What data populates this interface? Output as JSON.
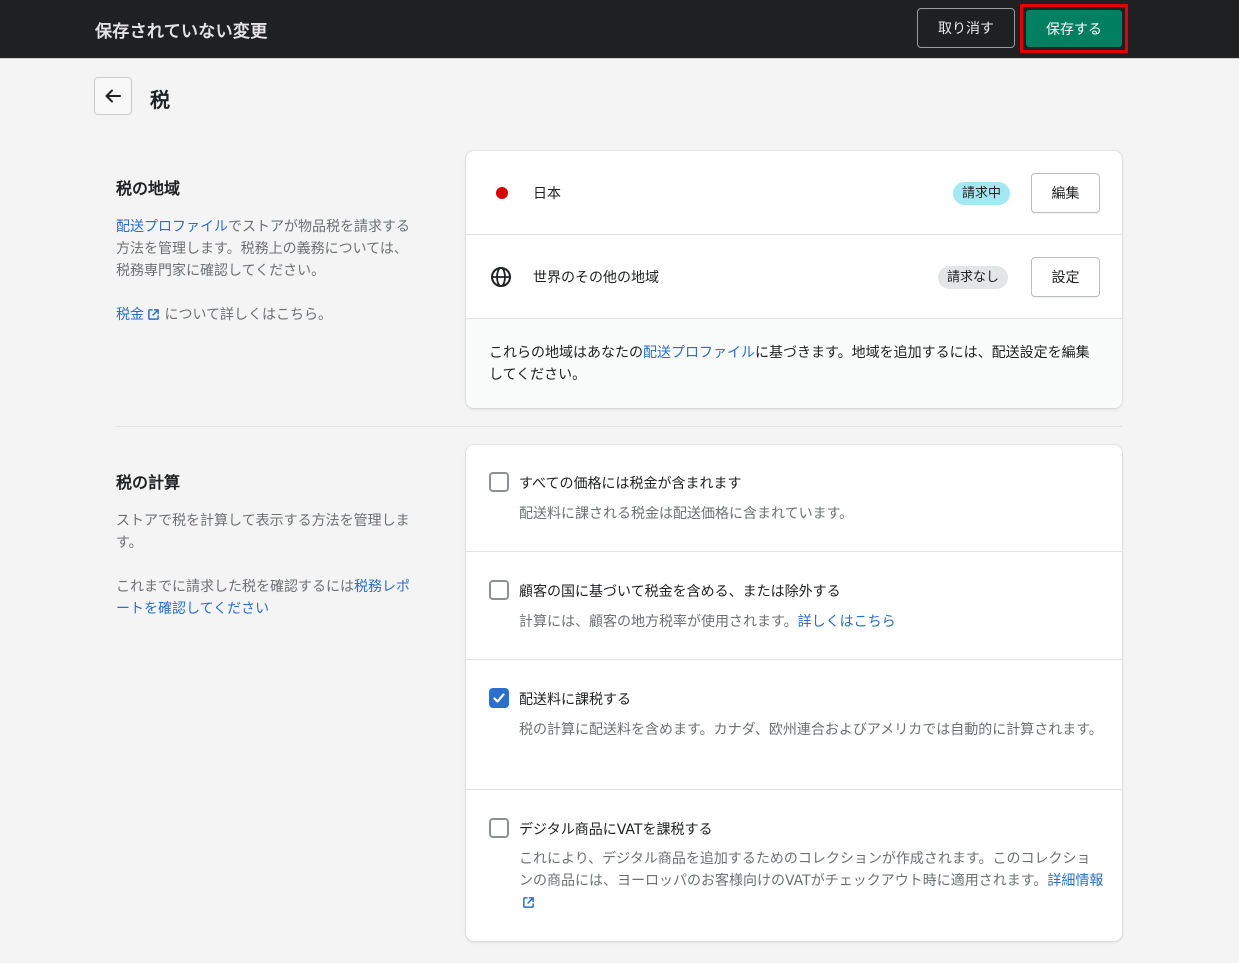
{
  "topbar": {
    "title": "保存されていない変更",
    "discard_label": "取り消す",
    "save_label": "保存する"
  },
  "page": {
    "title": "税",
    "back_icon": "arrow-left-icon"
  },
  "regions_section": {
    "title": "税の地域",
    "desc_link": "配送プロファイル",
    "desc_text": "でストアが物品税を請求する方法を管理します。税務上の義務については、税務専門家に確認してください。",
    "learn_link": "税金",
    "learn_text": "について詳しくはこちら。",
    "rows": [
      {
        "name": "日本",
        "icon": "red-dot-icon",
        "badge": "請求中",
        "button": "編集"
      },
      {
        "name": "世界のその他の地域",
        "icon": "globe-icon",
        "badge": "請求なし",
        "button": "設定"
      }
    ],
    "footer_pre": "これらの地域はあなたの",
    "footer_link": "配送プロファイル",
    "footer_post": "に基づきます。地域を追加するには、配送設定を編集してください。"
  },
  "calc_section": {
    "title": "税の計算",
    "desc": "ストアで税を計算して表示する方法を管理します。",
    "report_pre": "これまでに請求した税を確認するには",
    "report_link": "税務レポートを確認してください",
    "options": [
      {
        "label": "すべての価格には税金が含まれます",
        "checked": false,
        "help": "配送料に課される税金は配送価格に含まれています。"
      },
      {
        "label": "顧客の国に基づいて税金を含める、または除外する",
        "checked": false,
        "help": "計算には、顧客の地方税率が使用されます。",
        "help_link": "詳しくはこちら"
      },
      {
        "label": "配送料に課税する",
        "checked": true,
        "help": "税の計算に配送料を含めます。カナダ、欧州連合およびアメリカでは自動的に計算されます。"
      },
      {
        "label": "デジタル商品にVATを課税する",
        "checked": false,
        "help": "これにより、デジタル商品を追加するためのコレクションが作成されます。このコレクションの商品には、ヨーロッパのお客様向けのVATがチェックアウト時に適用されます。",
        "help_link": "詳細情報"
      }
    ]
  },
  "colors": {
    "topbar_bg": "#1f2022",
    "save_bg": "#008060",
    "highlight_border": "#e50000",
    "link": "#2c6ecb",
    "badge_active": "#a4e8f2",
    "badge_inactive": "#e4e5e7",
    "japan_dot": "#d40000"
  }
}
